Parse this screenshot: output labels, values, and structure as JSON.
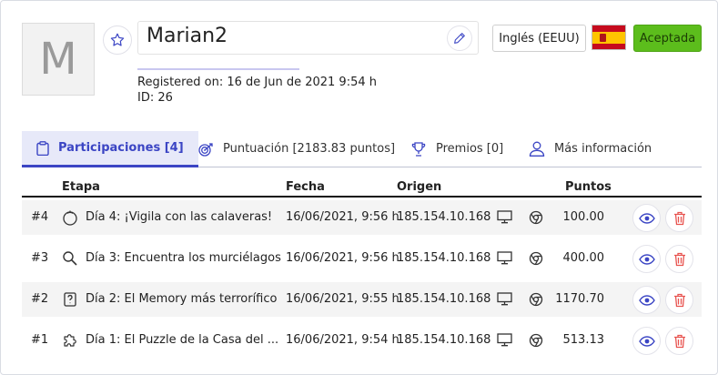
{
  "profile": {
    "avatar_initial": "M",
    "name": "Marian2",
    "registered": "Registered on: 16 de Jun de 2021 9:54 h",
    "id_text": "ID: 26",
    "language": "Inglés (EEUU)",
    "status": "Aceptada"
  },
  "colors": {
    "accent": "#3b45c4",
    "status_green": "#5cbd1c",
    "delete_red": "#e8534f"
  },
  "tabs": [
    {
      "label": "Participaciones [4]",
      "icon": "clipboard-icon",
      "active": true
    },
    {
      "label": "Puntuación [2183.83 puntos]",
      "icon": "target-icon",
      "active": false
    },
    {
      "label": "Premios [0]",
      "icon": "trophy-icon",
      "active": false
    },
    {
      "label": "Más información",
      "icon": "user-icon",
      "active": false
    }
  ],
  "table": {
    "headers": {
      "stage": "Etapa",
      "date": "Fecha",
      "origin": "Origen",
      "points": "Puntos"
    },
    "rows": [
      {
        "num": "#4",
        "stage_icon": "pumpkin-icon",
        "stage": "Día 4: ¡Vigila con las calaveras!",
        "date": "16/06/2021, 9:56 h",
        "ip": "185.154.10.168",
        "device": "desktop-icon",
        "browser": "chrome-icon",
        "points": "100.00"
      },
      {
        "num": "#3",
        "stage_icon": "magnifier-icon",
        "stage": "Día 3: Encuentra los murciélagos",
        "date": "16/06/2021, 9:56 h",
        "ip": "185.154.10.168",
        "device": "desktop-icon",
        "browser": "chrome-icon",
        "points": "400.00"
      },
      {
        "num": "#2",
        "stage_icon": "memory-card-icon",
        "stage": "Día 2: El Memory más terrorífico",
        "date": "16/06/2021, 9:55 h",
        "ip": "185.154.10.168",
        "device": "desktop-icon",
        "browser": "chrome-icon",
        "points": "1170.70"
      },
      {
        "num": "#1",
        "stage_icon": "puzzle-icon",
        "stage": "Día 1: El Puzzle de la Casa del ...",
        "date": "16/06/2021, 9:54 h",
        "ip": "185.154.10.168",
        "device": "desktop-icon",
        "browser": "chrome-icon",
        "points": "513.13"
      }
    ]
  }
}
